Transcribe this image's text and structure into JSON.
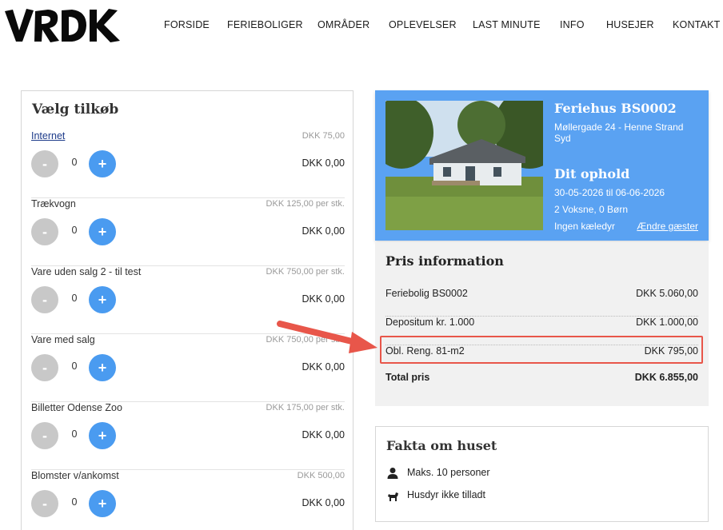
{
  "brand": {
    "logo_text": "VRDK"
  },
  "nav": [
    "FORSIDE",
    "FERIEBOLIGER",
    "OMRÅDER",
    "OPLEVELSER",
    "LAST MINUTE",
    "INFO",
    "HUSEJER",
    "KONTAKT"
  ],
  "addons": {
    "title": "Vælg tilkøb",
    "items": [
      {
        "name": "Internet",
        "unit_price": "DKK 75,00",
        "qty": "0",
        "total": "DKK 0,00"
      },
      {
        "name": "Trækvogn",
        "unit_price": "DKK 125,00 per stk.",
        "qty": "0",
        "total": "DKK 0,00"
      },
      {
        "name": "Vare uden salg 2 - til test",
        "unit_price": "DKK 750,00 per stk.",
        "qty": "0",
        "total": "DKK 0,00"
      },
      {
        "name": "Vare med salg",
        "unit_price": "DKK 750,00 per stk.",
        "qty": "0",
        "total": "DKK 0,00"
      },
      {
        "name": "Billetter Odense Zoo",
        "unit_price": "DKK 175,00 per stk.",
        "qty": "0",
        "total": "DKK 0,00"
      },
      {
        "name": "Blomster v/ankomst",
        "unit_price": "DKK 500,00",
        "qty": "0",
        "total": "DKK 0,00"
      }
    ],
    "minus_label": "-",
    "plus_label": "+"
  },
  "house": {
    "title": "Feriehus BS0002",
    "address": "Møllergade 24 - Henne Strand Syd",
    "stay_title": "Dit ophold",
    "dates": "30-05-2026 til 06-06-2026",
    "guests": "2 Voksne, 0 Børn",
    "pets": "Ingen kæledyr",
    "change_guests": "Ændre gæster"
  },
  "price": {
    "title": "Pris information",
    "rows": [
      {
        "label": "Feriebolig BS0002",
        "value": "DKK 5.060,00"
      },
      {
        "label": "Depositum kr. 1.000",
        "value": "DKK 1.000,00"
      },
      {
        "label": "Obl. Reng. 81-m2",
        "value": "DKK 795,00"
      }
    ],
    "total_label": "Total pris",
    "total_value": "DKK 6.855,00"
  },
  "facts": {
    "title": "Fakta om huset",
    "items": [
      {
        "icon": "person-icon",
        "text": "Maks. 10 personer"
      },
      {
        "icon": "dog-icon",
        "text": "Husdyr ikke tilladt"
      }
    ]
  },
  "colors": {
    "accent_blue": "#5aa2f2",
    "plus_blue": "#4a9bf0",
    "highlight_red": "#e8564a"
  }
}
